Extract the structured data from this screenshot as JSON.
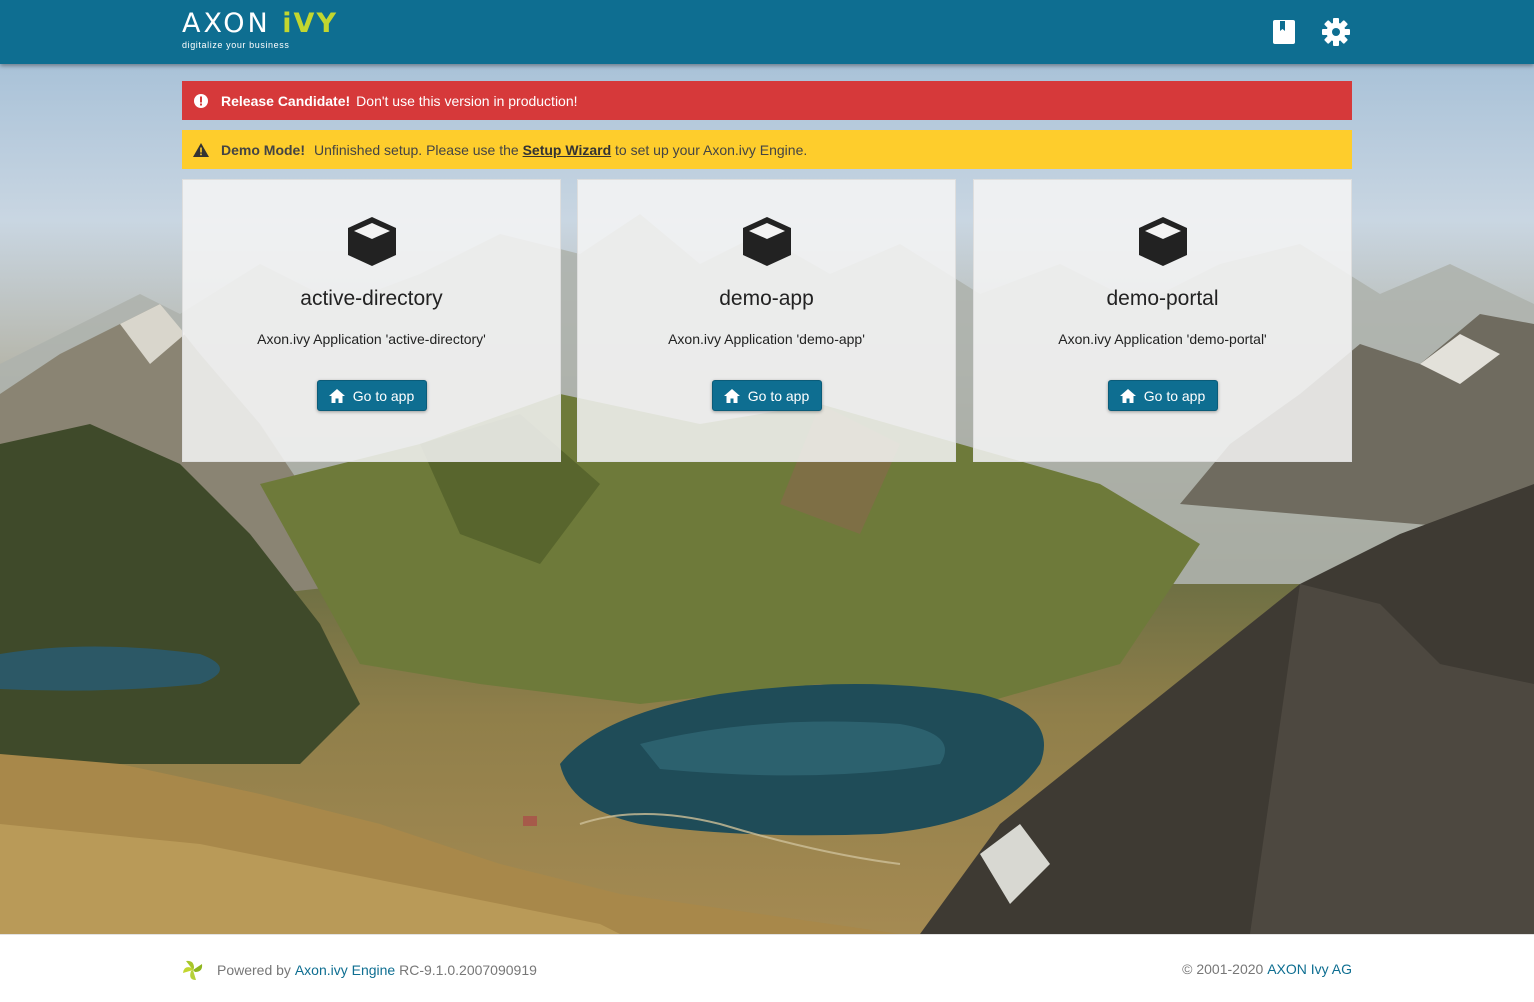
{
  "header": {
    "logo_word": "AXON",
    "logo_accent": "iVY",
    "logo_tagline": "digitalize your business",
    "icons": [
      "book-icon",
      "gear-icon"
    ]
  },
  "alerts": {
    "release": {
      "title": "Release Candidate!",
      "message": "Don't use this version in production!",
      "color": "#d6393a"
    },
    "demo": {
      "title": "Demo Mode!",
      "message_before": "Unfinished setup. Please use the",
      "link": "Setup Wizard",
      "message_after": "to set up your Axon.ivy Engine.",
      "color": "#fecd2c"
    }
  },
  "apps": [
    {
      "name": "active-directory",
      "description": "Axon.ivy Application 'active-directory'",
      "button": "Go to app"
    },
    {
      "name": "demo-app",
      "description": "Axon.ivy Application 'demo-app'",
      "button": "Go to app"
    },
    {
      "name": "demo-portal",
      "description": "Axon.ivy Application 'demo-portal'",
      "button": "Go to app"
    }
  ],
  "footer": {
    "powered_by": "Powered by",
    "engine_link": "Axon.ivy Engine",
    "version": "RC-9.1.0.2007090919",
    "copyright": "© 2001-2020",
    "company_link": "AXON Ivy AG"
  },
  "colors": {
    "brand": "#0e6e91",
    "accent": "#c2d62f"
  }
}
